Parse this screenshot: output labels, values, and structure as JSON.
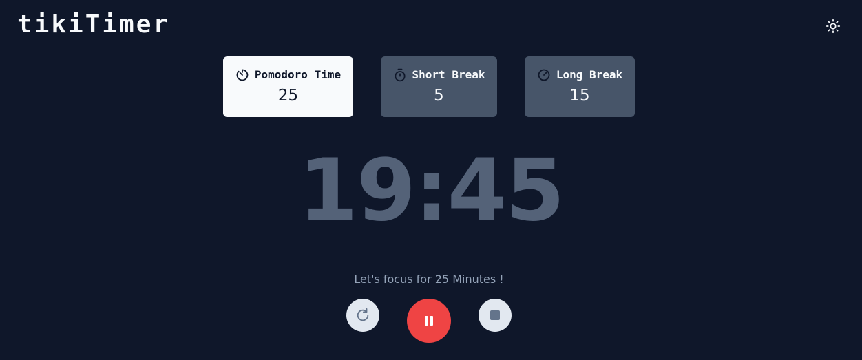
{
  "app": {
    "title": "tikiTimer"
  },
  "header": {
    "theme_toggle_icon": "sun-icon"
  },
  "modes": [
    {
      "label": "Pomodoro Time",
      "value": "25",
      "icon": "timer-icon",
      "active": true
    },
    {
      "label": "Short Break",
      "value": "5",
      "icon": "stopwatch-icon",
      "active": false
    },
    {
      "label": "Long Break",
      "value": "15",
      "icon": "gauge-icon",
      "active": false
    }
  ],
  "timer": {
    "display": "19:45"
  },
  "message": "Let's focus for 25 Minutes !",
  "controls": {
    "reset_icon": "rotate-cw-icon",
    "pause_icon": "pause-icon",
    "stop_icon": "stop-icon"
  },
  "colors": {
    "background": "#0f172a",
    "card_inactive": "#475569",
    "card_active": "#f8fafc",
    "timer_text": "#546278",
    "message_text": "#94a3b8",
    "pause_button": "#ef4444",
    "secondary_button": "#e2e8f0"
  }
}
